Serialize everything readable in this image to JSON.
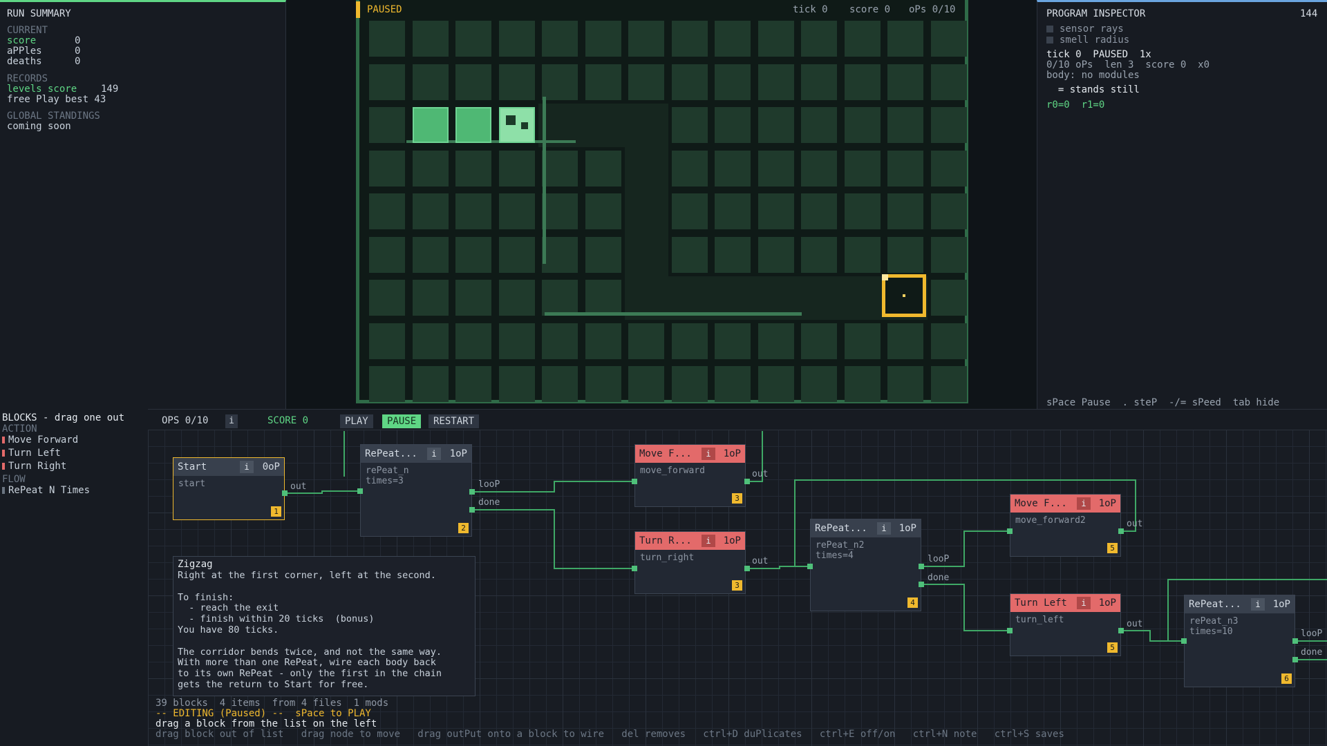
{
  "run_summary": {
    "title": "RUN SUMMARY",
    "current_label": "CURRENT",
    "score_label": "score",
    "score": "0",
    "apples_label": "aPPles",
    "apples": "0",
    "deaths_label": "deaths",
    "deaths": "0",
    "records_label": "RECORDS",
    "levels_score_label": "levels score",
    "levels_score": "149",
    "free_play_best": "free Play best 43",
    "global_label": "GLOBAL STANDINGS",
    "global_value": "coming soon"
  },
  "game": {
    "status": "PAUSED",
    "tick": "tick 0",
    "score": "score 0",
    "ops": "oPs 0/10"
  },
  "inspector": {
    "title": "PROGRAM INSPECTOR",
    "count": "144",
    "opt_sensor": "sensor rays",
    "opt_smell": "smell radius",
    "line1": "tick 0  PAUSED  1x",
    "line2": "0/10 oPs  len 3  score 0  x0",
    "line3": "body: no modules",
    "line4": "  = stands still",
    "line5": "r0=0  r1=0",
    "hints": "sPace Pause  . steP  -/= sPeed  tab hide"
  },
  "palette": {
    "title": "BLOCKS - drag one out",
    "action_label": "ACTION",
    "actions": [
      "Move Forward",
      "Turn Left",
      "Turn Right"
    ],
    "flow_label": "FLOW",
    "flows": [
      "RePeat N Times"
    ]
  },
  "toolbar": {
    "ops": "OPS 0/10",
    "info": "i",
    "score": "SCORE 0",
    "play": "PLAY",
    "pause": "PAUSE",
    "restart": "RESTART"
  },
  "nodes": {
    "start": {
      "title": "Start",
      "op": "0oP",
      "sub": "start",
      "num": "1",
      "out": "out"
    },
    "repeat": {
      "title": "RePeat...",
      "op": "1oP",
      "sub": "rePeat_n\ntimes=3",
      "num": "2",
      "loop": "looP",
      "done": "done"
    },
    "move1": {
      "title": "Move F...",
      "op": "1oP",
      "sub": "move_forward",
      "num": "3",
      "out": "out"
    },
    "turnr": {
      "title": "Turn R...",
      "op": "1oP",
      "sub": "turn_right",
      "num": "3",
      "out": "out"
    },
    "repeat2": {
      "title": "RePeat...",
      "op": "1oP",
      "sub": "rePeat_n2\ntimes=4",
      "num": "4",
      "loop": "looP",
      "done": "done"
    },
    "move2": {
      "title": "Move F...",
      "op": "1oP",
      "sub": "move_forward2",
      "num": "5",
      "out": "out"
    },
    "turnl": {
      "title": "Turn Left",
      "op": "1oP",
      "sub": "turn_left",
      "num": "5",
      "out": "out"
    },
    "repeat3": {
      "title": "RePeat...",
      "op": "1oP",
      "sub": "rePeat_n3\ntimes=10",
      "num": "6",
      "loop": "looP",
      "done": "done"
    }
  },
  "note": {
    "title": "Zigzag",
    "body": "Right at the first corner, left at the second.\n\nTo finish:\n  - reach the exit\n  - finish within 20 ticks  (bonus)\nYou have 80 ticks.\n\nThe corridor bends twice, and not the same way.\nWith more than one RePeat, wire each body back\nto its own RePeat - only the first in the chain\ngets the return to Start for free."
  },
  "footer": {
    "stats": "39 blocks  4 items  from 4 files  1 mods",
    "mode": "-- EDITING (Paused) --  sPace to PLAY",
    "hint": "drag a block from the list on the left",
    "keys": "drag block out of list   drag node to move   drag outPut onto a block to wire   del removes   ctrl+D duPlicates   ctrl+E off/on   ctrl+N note   ctrl+S saves"
  },
  "colors": {
    "accent_green": "#4fc07a",
    "wall": "#3c7a55",
    "exit": "#f0b92e",
    "action_red": "#e36a6a"
  }
}
